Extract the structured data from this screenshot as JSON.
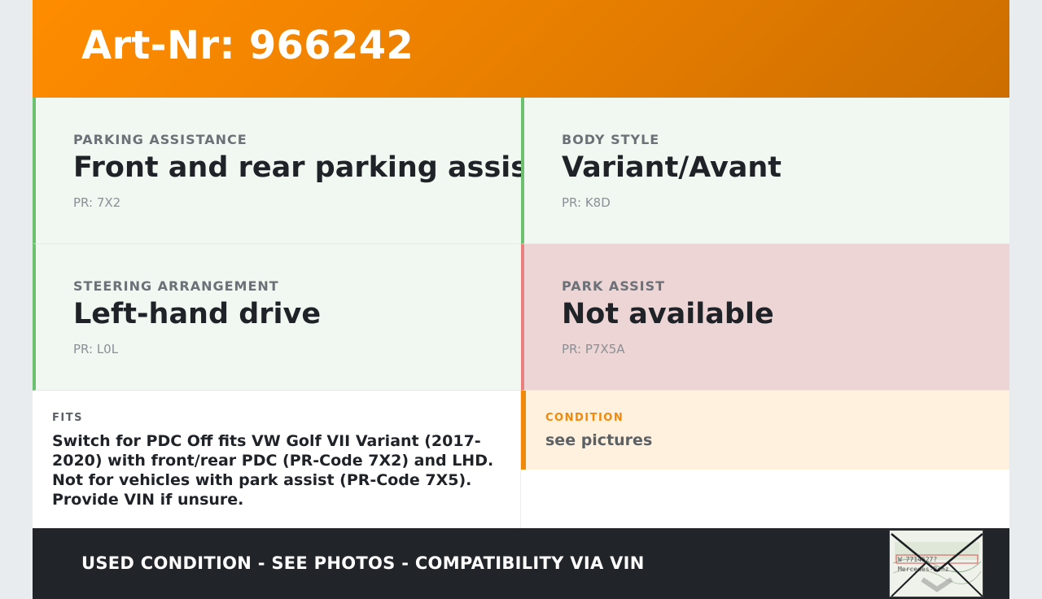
{
  "header": {
    "title": "Art-Nr: 966242"
  },
  "specs": [
    {
      "label": "PARKING ASSISTANCE",
      "value": "Front and rear parking assist",
      "pr": "PR: 7X2",
      "status": "ok"
    },
    {
      "label": "BODY STYLE",
      "value": "Variant/Avant",
      "pr": "PR: K8D",
      "status": "ok"
    },
    {
      "label": "STEERING ARRANGEMENT",
      "value": "Left-hand drive",
      "pr": "PR: L0L",
      "status": "ok"
    },
    {
      "label": "PARK ASSIST",
      "value": "Not available",
      "pr": "PR: P7X5A",
      "status": "excluded"
    }
  ],
  "fits": {
    "label": "FITS",
    "text": "Switch for PDC Off fits VW Golf VII Variant (2017-2020) with front/rear PDC (PR-Code 7X2) and LHD. Not for vehicles with park assist (PR-Code 7X5). Provide VIN if unsure."
  },
  "condition": {
    "label": "CONDITION",
    "text": "see pictures"
  },
  "footer": {
    "text": "USED CONDITION - SEE PHOTOS - COMPATIBILITY VIA VIN",
    "thumbnail_text": "W 7714627? Mercedes-Benz"
  },
  "colors": {
    "accent": "#ff8c00",
    "ok_border": "#6cc070",
    "ok_bg": "#f1f8f1",
    "excluded_border": "#e88080",
    "excluded_bg": "#edd4d5",
    "footer_bg": "#212529"
  }
}
